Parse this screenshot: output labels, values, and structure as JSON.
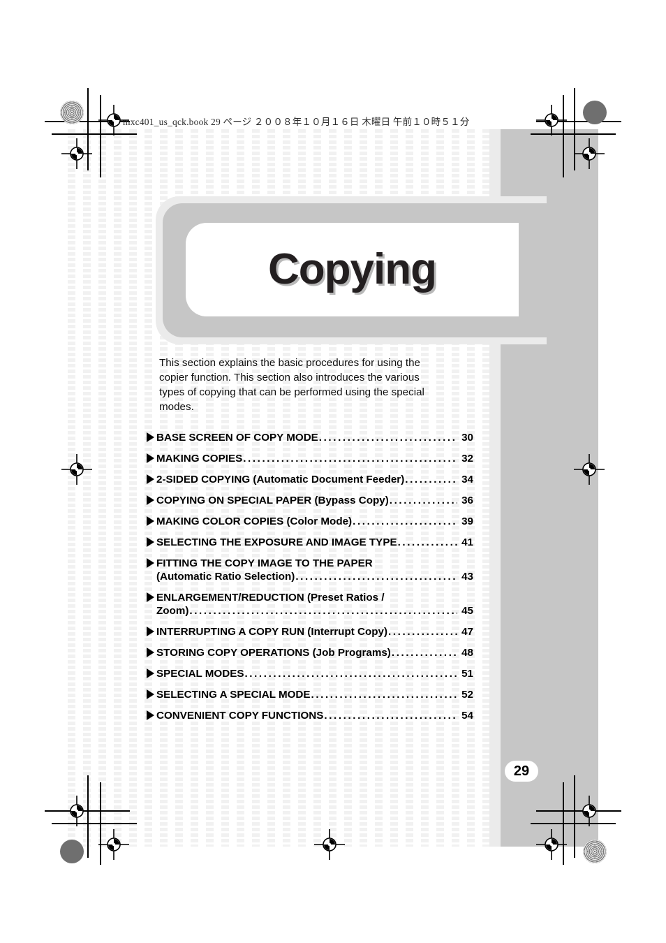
{
  "document": {
    "header_stamp": "mxc401_us_qck.book  29 ページ  ２００８年１０月１６日  木曜日  午前１０時５１分",
    "chapter_title": "Copying",
    "page_number": "29",
    "intro_paragraph": "This section explains the basic procedures for using the copier function. This section also introduces the various types of copying that can be performed using the special modes."
  },
  "colors": {
    "sidebar_gray": "#c6c6c6",
    "banner_outer_gray": "#ebebeb",
    "banner_mid_gray": "#c6c6c6",
    "title_text": "#231f20",
    "title_shadow": "#b9b9b9",
    "pattern_tint": "#f1f1f1"
  },
  "toc": {
    "dots": "...................................................................",
    "entries": [
      {
        "label": "BASE SCREEN OF COPY MODE",
        "label2": "",
        "page": "30"
      },
      {
        "label": "MAKING COPIES",
        "label2": "",
        "page": "32"
      },
      {
        "label": "2-SIDED COPYING (Automatic Document Feeder)",
        "label2": "",
        "page": "34"
      },
      {
        "label": "COPYING ON SPECIAL PAPER (Bypass Copy)",
        "label2": "",
        "page": "36"
      },
      {
        "label": "MAKING COLOR COPIES (Color Mode)",
        "label2": "",
        "page": "39"
      },
      {
        "label": "SELECTING THE EXPOSURE AND IMAGE TYPE",
        "label2": "",
        "page": "41"
      },
      {
        "label": "FITTING THE COPY IMAGE TO THE PAPER",
        "label2": "(Automatic Ratio Selection)",
        "page": "43"
      },
      {
        "label": "ENLARGEMENT/REDUCTION (Preset Ratios /",
        "label2": "Zoom)",
        "page": "45"
      },
      {
        "label": "INTERRUPTING A COPY RUN (Interrupt Copy)",
        "label2": "",
        "page": "47"
      },
      {
        "label": "STORING COPY OPERATIONS (Job Programs)",
        "label2": "",
        "page": "48"
      },
      {
        "label": "SPECIAL MODES",
        "label2": "",
        "page": "51"
      },
      {
        "label": "SELECTING A SPECIAL MODE",
        "label2": "",
        "page": "52"
      },
      {
        "label": "CONVENIENT COPY FUNCTIONS",
        "label2": "",
        "page": "54"
      }
    ]
  }
}
